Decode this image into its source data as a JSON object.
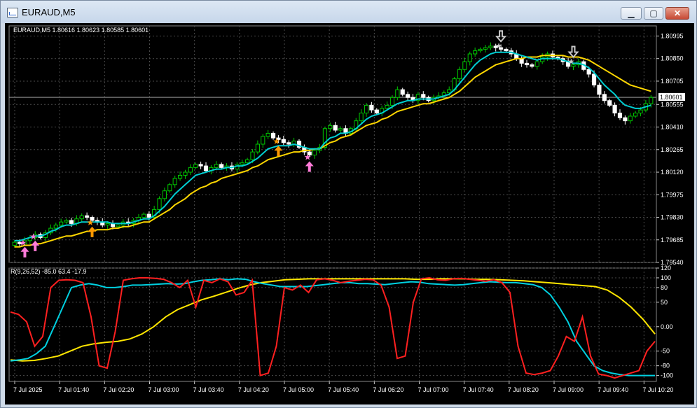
{
  "window": {
    "title": "EURAUD,M5",
    "minimize_glyph": "▁",
    "maximize_glyph": "▢",
    "close_glyph": "✕"
  },
  "colors": {
    "background": "#000000",
    "grid": "#4a4a4a",
    "axis_text": "#ffffff",
    "bull_candle": "#00c800",
    "bear_candle": "#ffffff",
    "fast_ma": "#00ced1",
    "slow_ma": "#ffd700",
    "osc_fast": "#ff2020",
    "osc_signal": "#00d0e0",
    "osc_slow": "#ffe600",
    "buy_arrow_pink": "#ff7bd8",
    "buy_arrow_orange": "#ff9900",
    "sell_arrow_gray": "#c8c8c8"
  },
  "main_panel": {
    "info_label": "EURAUD,M5 1.80616 1.80623 1.80585 1.80601",
    "current_price": "1.80601",
    "price_ticks": [
      "1.80995",
      "1.80850",
      "1.80705",
      "1.80555",
      "1.80410",
      "1.80265",
      "1.80120",
      "1.79975",
      "1.79830",
      "1.79685",
      "1.79540"
    ]
  },
  "sub_panel": {
    "info_label": "R(9,26,52) -85.0 63.4 -17.9",
    "ticks": [
      "120",
      "100",
      "80",
      "50",
      "0.00",
      "-50",
      "-80",
      "-100"
    ]
  },
  "time_axis": [
    "7 Jul 2025",
    "7 Jul 01:40",
    "7 Jul 02:20",
    "7 Jul 03:00",
    "7 Jul 03:40",
    "7 Jul 04:20",
    "7 Jul 05:00",
    "7 Jul 05:40",
    "7 Jul 06:20",
    "7 Jul 07:00",
    "7 Jul 07:40",
    "7 Jul 08:20",
    "7 Jul 09:00",
    "7 Jul 09:40",
    "7 Jul 10:20"
  ],
  "chart_data": {
    "type": "candlestick",
    "symbol": "EURAUD",
    "timeframe": "M5",
    "price_range": [
      1.7954,
      1.8106
    ],
    "close_series": [
      1.7967,
      1.7966,
      1.7968,
      1.797,
      1.7972,
      1.797,
      1.7973,
      1.7976,
      1.7978,
      1.798,
      1.7981,
      1.7979,
      1.7982,
      1.7984,
      1.7983,
      1.7981,
      1.798,
      1.7978,
      1.7979,
      1.7977,
      1.7978,
      1.798,
      1.7979,
      1.7981,
      1.7983,
      1.7985,
      1.7983,
      1.7988,
      1.7995,
      1.8,
      1.8004,
      1.8008,
      1.801,
      1.8012,
      1.8015,
      1.8017,
      1.8016,
      1.8013,
      1.8015,
      1.8017,
      1.8015,
      1.8016,
      1.8014,
      1.8017,
      1.8018,
      1.802,
      1.8025,
      1.803,
      1.8035,
      1.8037,
      1.8034,
      1.8033,
      1.8031,
      1.803,
      1.8032,
      1.8028,
      1.8025,
      1.8023,
      1.8026,
      1.8028,
      1.804,
      1.8042,
      1.8039,
      1.804,
      1.8037,
      1.804,
      1.8045,
      1.805,
      1.8055,
      1.8052,
      1.805,
      1.8053,
      1.8055,
      1.806,
      1.8065,
      1.8062,
      1.806,
      1.8058,
      1.8062,
      1.806,
      1.8058,
      1.806,
      1.8061,
      1.8063,
      1.8065,
      1.8072,
      1.8078,
      1.8083,
      1.8088,
      1.809,
      1.8091,
      1.8092,
      1.8093,
      1.8092,
      1.8091,
      1.809,
      1.8088,
      1.8085,
      1.8082,
      1.8081,
      1.808,
      1.8083,
      1.8086,
      1.8088,
      1.8086,
      1.8085,
      1.8083,
      1.808,
      1.8081,
      1.8083,
      1.8078,
      1.8075,
      1.8068,
      1.8062,
      1.8058,
      1.8055,
      1.805,
      1.8047,
      1.8045,
      1.8048,
      1.805,
      1.8052,
      1.8056,
      1.806
    ],
    "fast_ma": [
      1.7968,
      1.7968,
      1.7969,
      1.797,
      1.7971,
      1.7971,
      1.7972,
      1.7974,
      1.7975,
      1.7977,
      1.7978,
      1.7978,
      1.7979,
      1.798,
      1.798,
      1.798,
      1.798,
      1.798,
      1.798,
      1.7979,
      1.7979,
      1.7979,
      1.7979,
      1.798,
      1.7981,
      1.7982,
      1.7982,
      1.7984,
      1.7987,
      1.799,
      1.7994,
      1.7998,
      1.8001,
      1.8004,
      1.8007,
      1.801,
      1.8011,
      1.8012,
      1.8013,
      1.8014,
      1.8014,
      1.8015,
      1.8015,
      1.8016,
      1.8016,
      1.8017,
      1.8019,
      1.8021,
      1.8024,
      1.8027,
      1.8028,
      1.8029,
      1.8029,
      1.8029,
      1.803,
      1.8029,
      1.8028,
      1.8027,
      1.8027,
      1.8027,
      1.8031,
      1.8034,
      1.8035,
      1.8037,
      1.8037,
      1.8038,
      1.804,
      1.8043,
      1.8046,
      1.8048,
      1.8049,
      1.805,
      1.8052,
      1.8054,
      1.8056,
      1.8057,
      1.8058,
      1.8058,
      1.8059,
      1.8059,
      1.8059,
      1.8059,
      1.806,
      1.8061,
      1.8062,
      1.8065,
      1.8069,
      1.8073,
      1.8077,
      1.8081,
      1.8084,
      1.8086,
      1.8088,
      1.8089,
      1.8089,
      1.8089,
      1.8089,
      1.8088,
      1.8087,
      1.8086,
      1.8085,
      1.8084,
      1.8085,
      1.8085,
      1.8085,
      1.8085,
      1.8084,
      1.8083,
      1.8082,
      1.8082,
      1.8081,
      1.8079,
      1.8076,
      1.8072,
      1.8068,
      1.8065,
      1.8062,
      1.8058,
      1.8055,
      1.8054,
      1.8053,
      1.8053,
      1.8054,
      1.8055
    ],
    "slow_ma": [
      1.7964,
      1.7964,
      1.7965,
      1.7965,
      1.7966,
      1.7966,
      1.7967,
      1.7968,
      1.7969,
      1.797,
      1.7971,
      1.7971,
      1.7972,
      1.7973,
      1.7974,
      1.7974,
      1.7975,
      1.7975,
      1.7975,
      1.7976,
      1.7976,
      1.7977,
      1.7977,
      1.7978,
      1.7979,
      1.798,
      1.798,
      1.7982,
      1.7984,
      1.7986,
      1.7988,
      1.7991,
      1.7993,
      1.7995,
      1.7998,
      1.8,
      1.8002,
      1.8003,
      1.8005,
      1.8006,
      1.8008,
      1.8009,
      1.801,
      1.8011,
      1.8012,
      1.8013,
      1.8015,
      1.8016,
      1.8018,
      1.802,
      1.8021,
      1.8022,
      1.8023,
      1.8024,
      1.8025,
      1.8025,
      1.8026,
      1.8026,
      1.8027,
      1.8027,
      1.8029,
      1.8031,
      1.8032,
      1.8034,
      1.8035,
      1.8036,
      1.8038,
      1.804,
      1.8042,
      1.8043,
      1.8044,
      1.8046,
      1.8047,
      1.8049,
      1.8051,
      1.8052,
      1.8053,
      1.8054,
      1.8055,
      1.8056,
      1.8056,
      1.8057,
      1.8058,
      1.8059,
      1.806,
      1.8062,
      1.8064,
      1.8067,
      1.807,
      1.8073,
      1.8075,
      1.8077,
      1.8079,
      1.8081,
      1.8082,
      1.8083,
      1.8084,
      1.8085,
      1.8085,
      1.8086,
      1.8086,
      1.8086,
      1.8087,
      1.8087,
      1.8087,
      1.8087,
      1.8087,
      1.8086,
      1.8086,
      1.8086,
      1.8085,
      1.8084,
      1.8082,
      1.808,
      1.8078,
      1.8076,
      1.8074,
      1.8072,
      1.807,
      1.8068,
      1.8067,
      1.8066,
      1.8065,
      1.8064
    ],
    "oscillator": {
      "range": [
        -112,
        120
      ],
      "fast_red": [
        30,
        25,
        10,
        -40,
        -20,
        80,
        95,
        96,
        95,
        90,
        20,
        -80,
        -85,
        -10,
        95,
        98,
        100,
        100,
        99,
        97,
        90,
        80,
        95,
        40,
        95,
        90,
        98,
        92,
        65,
        70,
        95,
        -100,
        -95,
        -40,
        80,
        75,
        85,
        70,
        96,
        98,
        95,
        90,
        93,
        95,
        97,
        96,
        85,
        40,
        -65,
        -60,
        50,
        98,
        100,
        96,
        95,
        98,
        99,
        97,
        95,
        93,
        96,
        90,
        70,
        -40,
        -95,
        -98,
        -95,
        -90,
        -60,
        -20,
        -30,
        20,
        -60,
        -97,
        -100,
        -105,
        -100,
        -95,
        -90,
        -50,
        -30
      ],
      "signal_cyan": [
        -70,
        -68,
        -65,
        -55,
        -40,
        0,
        40,
        80,
        85,
        88,
        85,
        80,
        80,
        82,
        85,
        85,
        86,
        87,
        88,
        87,
        88,
        92,
        95,
        96,
        98,
        96,
        98,
        97,
        92,
        88,
        85,
        82,
        82,
        82,
        82,
        84,
        86,
        88,
        90,
        90,
        88,
        88,
        87,
        86,
        88,
        90,
        92,
        91,
        88,
        87,
        86,
        85,
        86,
        88,
        90,
        92,
        91,
        90,
        90,
        88,
        86,
        80,
        65,
        40,
        10,
        -30,
        -55,
        -80,
        -90,
        -95,
        -98,
        -100,
        -100,
        -100,
        -100
      ],
      "slow_yellow": [
        -68,
        -70,
        -69,
        -65,
        -60,
        -50,
        -40,
        -35,
        -32,
        -30,
        -25,
        -15,
        0,
        20,
        35,
        45,
        55,
        62,
        70,
        78,
        85,
        90,
        93,
        96,
        97,
        98,
        98,
        98,
        98,
        98,
        98,
        98,
        98,
        98,
        97,
        97,
        98,
        98,
        98,
        97,
        97,
        96,
        95,
        94,
        92,
        90,
        88,
        86,
        84,
        82,
        75,
        60,
        40,
        15,
        -15
      ]
    },
    "signals": [
      {
        "type": "buy",
        "color": "pink",
        "bar": 2
      },
      {
        "type": "buy",
        "color": "pink",
        "bar": 4
      },
      {
        "type": "buy",
        "color": "orange",
        "bar": 15
      },
      {
        "type": "buy",
        "color": "orange",
        "bar": 51
      },
      {
        "type": "buy",
        "color": "pink",
        "bar": 57
      },
      {
        "type": "sell",
        "color": "gray",
        "bar": 94
      },
      {
        "type": "sell",
        "color": "gray",
        "bar": 108
      }
    ]
  }
}
